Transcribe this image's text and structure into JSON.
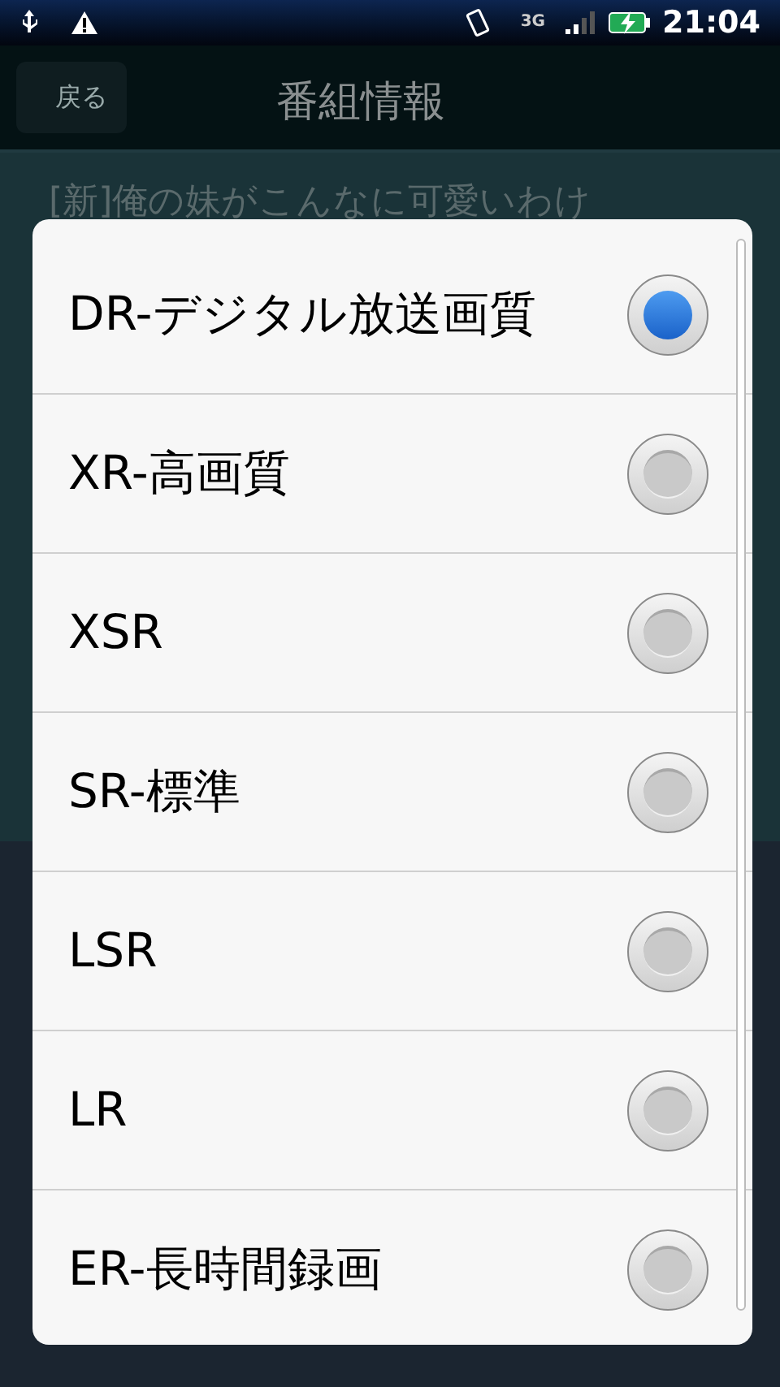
{
  "status_bar": {
    "time": "21:04",
    "network": "3G"
  },
  "header": {
    "back": "戻る",
    "title": "番組情報"
  },
  "program_title": "[新]俺の妹がこんなに可愛いわけ",
  "options": [
    {
      "label": "DR-デジタル放送画質",
      "selected": true
    },
    {
      "label": "XR-高画質",
      "selected": false
    },
    {
      "label": "XSR",
      "selected": false
    },
    {
      "label": "SR-標準",
      "selected": false
    },
    {
      "label": "LSR",
      "selected": false
    },
    {
      "label": "LR",
      "selected": false
    },
    {
      "label": "ER-長時間録画",
      "selected": false
    }
  ]
}
